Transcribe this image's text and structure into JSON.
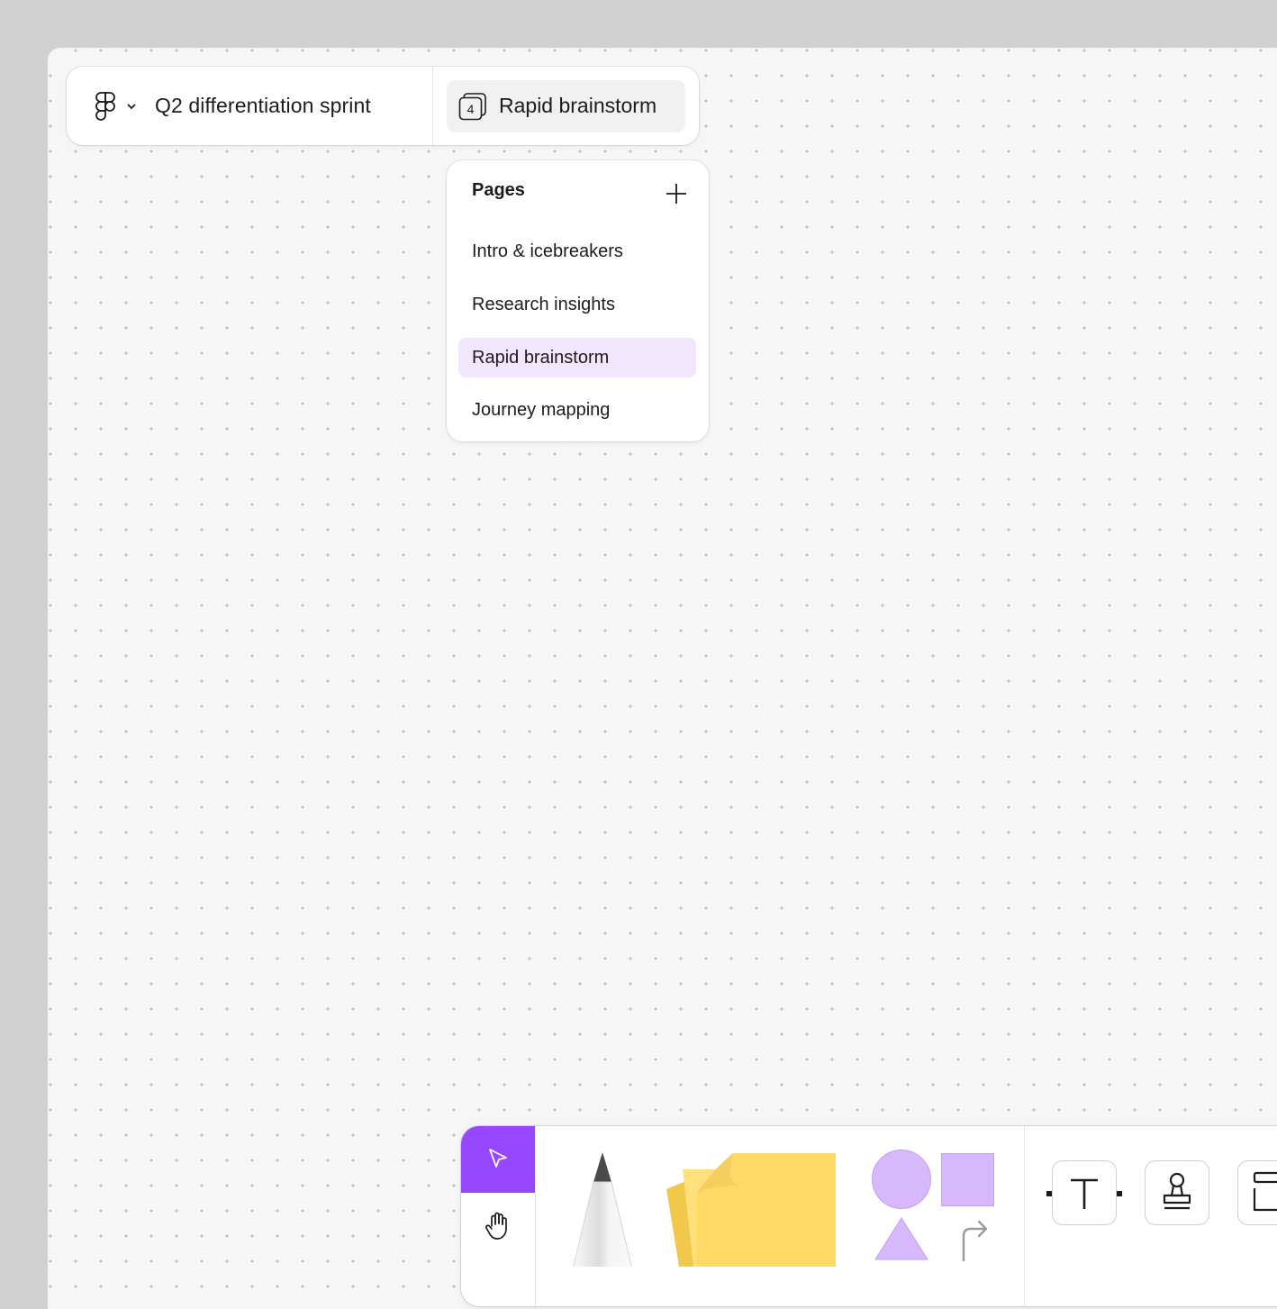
{
  "header": {
    "file_title": "Q2 differentiation sprint",
    "current_page_label": "Rapid brainstorm",
    "page_count": "4"
  },
  "pages_panel": {
    "title": "Pages",
    "items": [
      {
        "label": "Intro & icebreakers",
        "active": false
      },
      {
        "label": "Research insights",
        "active": false
      },
      {
        "label": "Rapid brainstorm",
        "active": true
      },
      {
        "label": "Journey mapping",
        "active": false
      }
    ]
  },
  "toolbar": {
    "tools": [
      "select-icon",
      "hand-icon",
      "pen-icon",
      "sticky-note-icon",
      "circle-icon",
      "square-icon",
      "triangle-icon",
      "connector-icon",
      "text-icon",
      "stamp-icon",
      "section-icon"
    ]
  },
  "colors": {
    "accent": "#9747ff",
    "active_page_bg": "#f1e6fd",
    "sticky_yellow": "#ffd966",
    "shape_purple": "#d7b8fc"
  }
}
